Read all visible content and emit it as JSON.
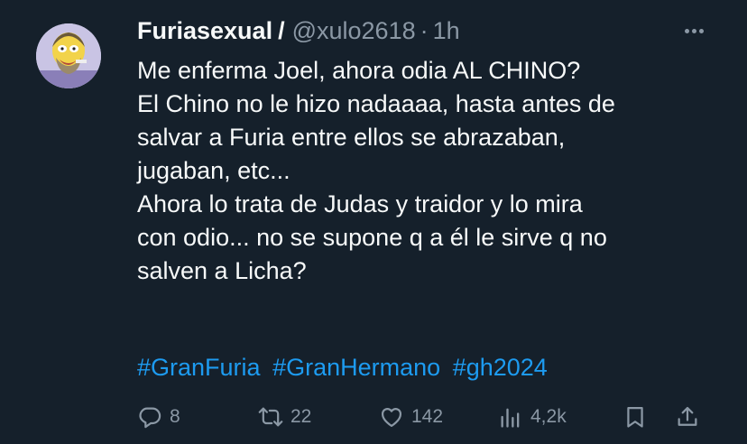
{
  "author": {
    "name": "Furiasexual",
    "separator": "/",
    "handle": "@xulo2618",
    "dot": "·",
    "time": "1h"
  },
  "tweet": {
    "lines": [
      "Me enferma Joel, ahora odia AL CHINO?",
      "El Chino no le hizo nadaaaa, hasta antes de",
      "salvar a Furia entre ellos se abrazaban,",
      "jugaban, etc...",
      "Ahora lo trata de Judas y traidor y lo mira",
      "con odio... no se supone q a él le sirve q no",
      "salven a Licha?"
    ],
    "hashtags": [
      "#GranFuria",
      "#GranHermano",
      "#gh2024"
    ]
  },
  "actions": {
    "replies": "8",
    "retweets": "22",
    "likes": "142",
    "views": "4,2k"
  },
  "colors": {
    "background": "#15202b",
    "text": "#f7f9f9",
    "muted": "#8b98a5",
    "link": "#1d9bf0"
  },
  "icons": [
    "more-icon",
    "reply-icon",
    "retweet-icon",
    "like-icon",
    "views-icon",
    "bookmark-icon",
    "share-icon"
  ]
}
